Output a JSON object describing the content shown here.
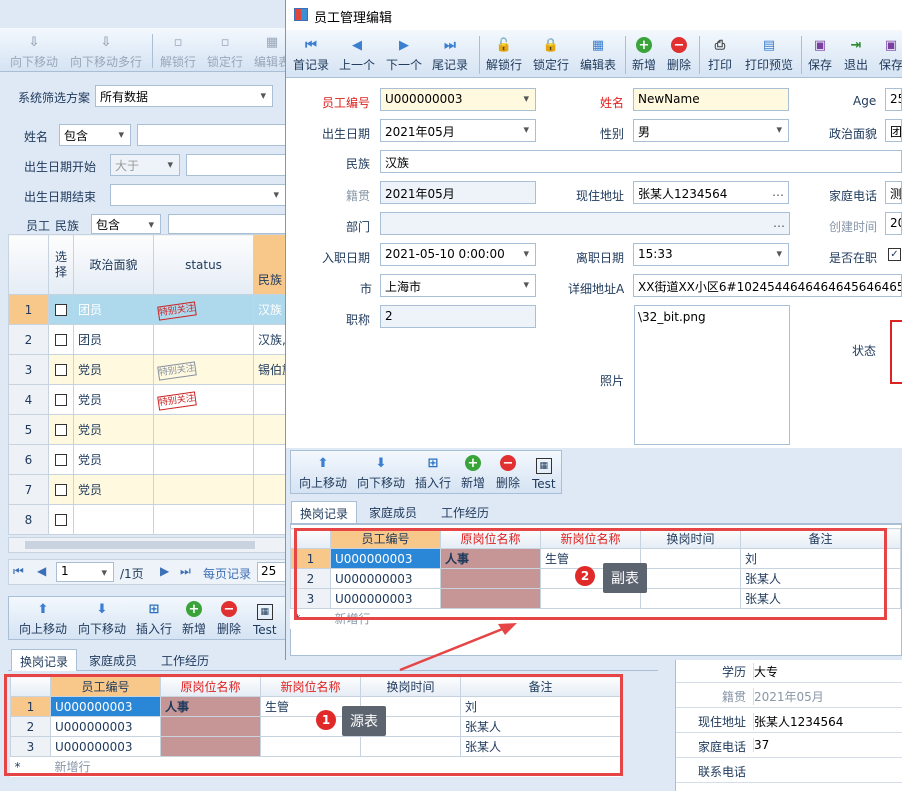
{
  "bg": {
    "toolbar": [
      "向下移动",
      "向下移动多行",
      "解锁行",
      "锁定行",
      "编辑表"
    ],
    "filter_scheme_label": "系统筛选方案",
    "filter_scheme_value": "所有数据",
    "name_label": "姓名",
    "name_op": "包含",
    "birth_start_label": "出生日期开始",
    "birth_start_op": "大于",
    "birth_end_label": "出生日期结束",
    "staff_label": "员工",
    "ethnic_label": "民族",
    "ethnic_op": "包含",
    "grid_headers": [
      "选择",
      "政治面貌",
      "status",
      "民族"
    ],
    "rows": [
      {
        "n": "1",
        "party": "团员",
        "stamp": "red",
        "eth": "汉族"
      },
      {
        "n": "2",
        "party": "团员",
        "stamp": "",
        "eth": "汉族,"
      },
      {
        "n": "3",
        "party": "党员",
        "stamp": "gray",
        "eth": "锡伯族"
      },
      {
        "n": "4",
        "party": "党员",
        "stamp": "red",
        "eth": ""
      },
      {
        "n": "5",
        "party": "党员",
        "stamp": "",
        "eth": ""
      },
      {
        "n": "6",
        "party": "党员",
        "stamp": "",
        "eth": ""
      },
      {
        "n": "7",
        "party": "党员",
        "stamp": "",
        "eth": ""
      },
      {
        "n": "8",
        "party": "",
        "stamp": "",
        "eth": ""
      }
    ],
    "stamp_text": "特别关注",
    "pager_page": "1",
    "pager_total": "/1页",
    "pager_per_label": "每页记录",
    "pager_per_value": "25",
    "sub_toolbar": [
      "向上移动",
      "向下移动",
      "插入行",
      "新增",
      "删除",
      "Test"
    ],
    "tabs": [
      "换岗记录",
      "家庭成员",
      "工作经历"
    ],
    "right_rows": [
      {
        "label": "学历",
        "value": "大专"
      },
      {
        "label": "籍贯",
        "value": "2021年05月"
      },
      {
        "label": "现住地址",
        "value": "张某人1234564"
      },
      {
        "label": "家庭电话",
        "value": "37"
      },
      {
        "label": "联系电话",
        "value": ""
      }
    ]
  },
  "dialog": {
    "title": "员工管理编辑",
    "toolbar": [
      "首记录",
      "上一个",
      "下一个",
      "尾记录",
      "解锁行",
      "锁定行",
      "编辑表",
      "新增",
      "删除",
      "打印",
      "打印预览",
      "保存",
      "退出",
      "保存"
    ],
    "fields": {
      "emp_no_label": "员工编号",
      "emp_no": "U000000003",
      "name_label": "姓名",
      "name": "NewName",
      "age_label": "Age",
      "age": "25",
      "birth_label": "出生日期",
      "birth": "2021年05月",
      "gender_label": "性别",
      "gender": "男",
      "party_label": "政治面貌",
      "party": "团",
      "ethnic_label": "民族",
      "ethnic": "汉族",
      "native_label": "籍贯",
      "native": "2021年05月",
      "addr_label": "现住地址",
      "addr": "张某人1234564",
      "phone_label": "家庭电话",
      "phone": "测",
      "dept_label": "部门",
      "dept": "",
      "created_label": "创建时间",
      "created": "20",
      "join_label": "入职日期",
      "join": "2021-05-10 0:00:00",
      "leave_label": "离职日期",
      "leave": "15:33",
      "active_label": "是否在职",
      "city_label": "市",
      "city": "上海市",
      "detail_label": "详细地址A",
      "detail": "XX街道XX小区6#10245446464646456464654",
      "title_label": "职称",
      "title": "2",
      "photo_label": "照片",
      "photo": "\\32_bit.png",
      "status_label": "状态"
    },
    "sub_toolbar": [
      "向上移动",
      "向下移动",
      "插入行",
      "新增",
      "删除",
      "Test"
    ],
    "tabs": [
      "换岗记录",
      "家庭成员",
      "工作经历"
    ]
  },
  "grid": {
    "headers": [
      "员工编号",
      "原岗位名称",
      "新岗位名称",
      "换岗时间",
      "备注"
    ],
    "rows": [
      {
        "n": "1",
        "id": "U000000003",
        "old": "人事",
        "new": "生管",
        "time": "",
        "note": "刘"
      },
      {
        "n": "2",
        "id": "U000000003",
        "old": "",
        "new": "",
        "time": "",
        "note": "张某人"
      },
      {
        "n": "3",
        "id": "U000000003",
        "old": "",
        "new": "",
        "time": "",
        "note": "张某人"
      }
    ],
    "new_row_marker": "*",
    "new_row": "新增行"
  },
  "annotations": {
    "source_num": "1",
    "source_label": "源表",
    "target_num": "2",
    "target_label": "副表"
  },
  "colors": {
    "highlight": "#e54545",
    "selected_header": "#f8c88a",
    "pink_cell": "#c69696"
  }
}
